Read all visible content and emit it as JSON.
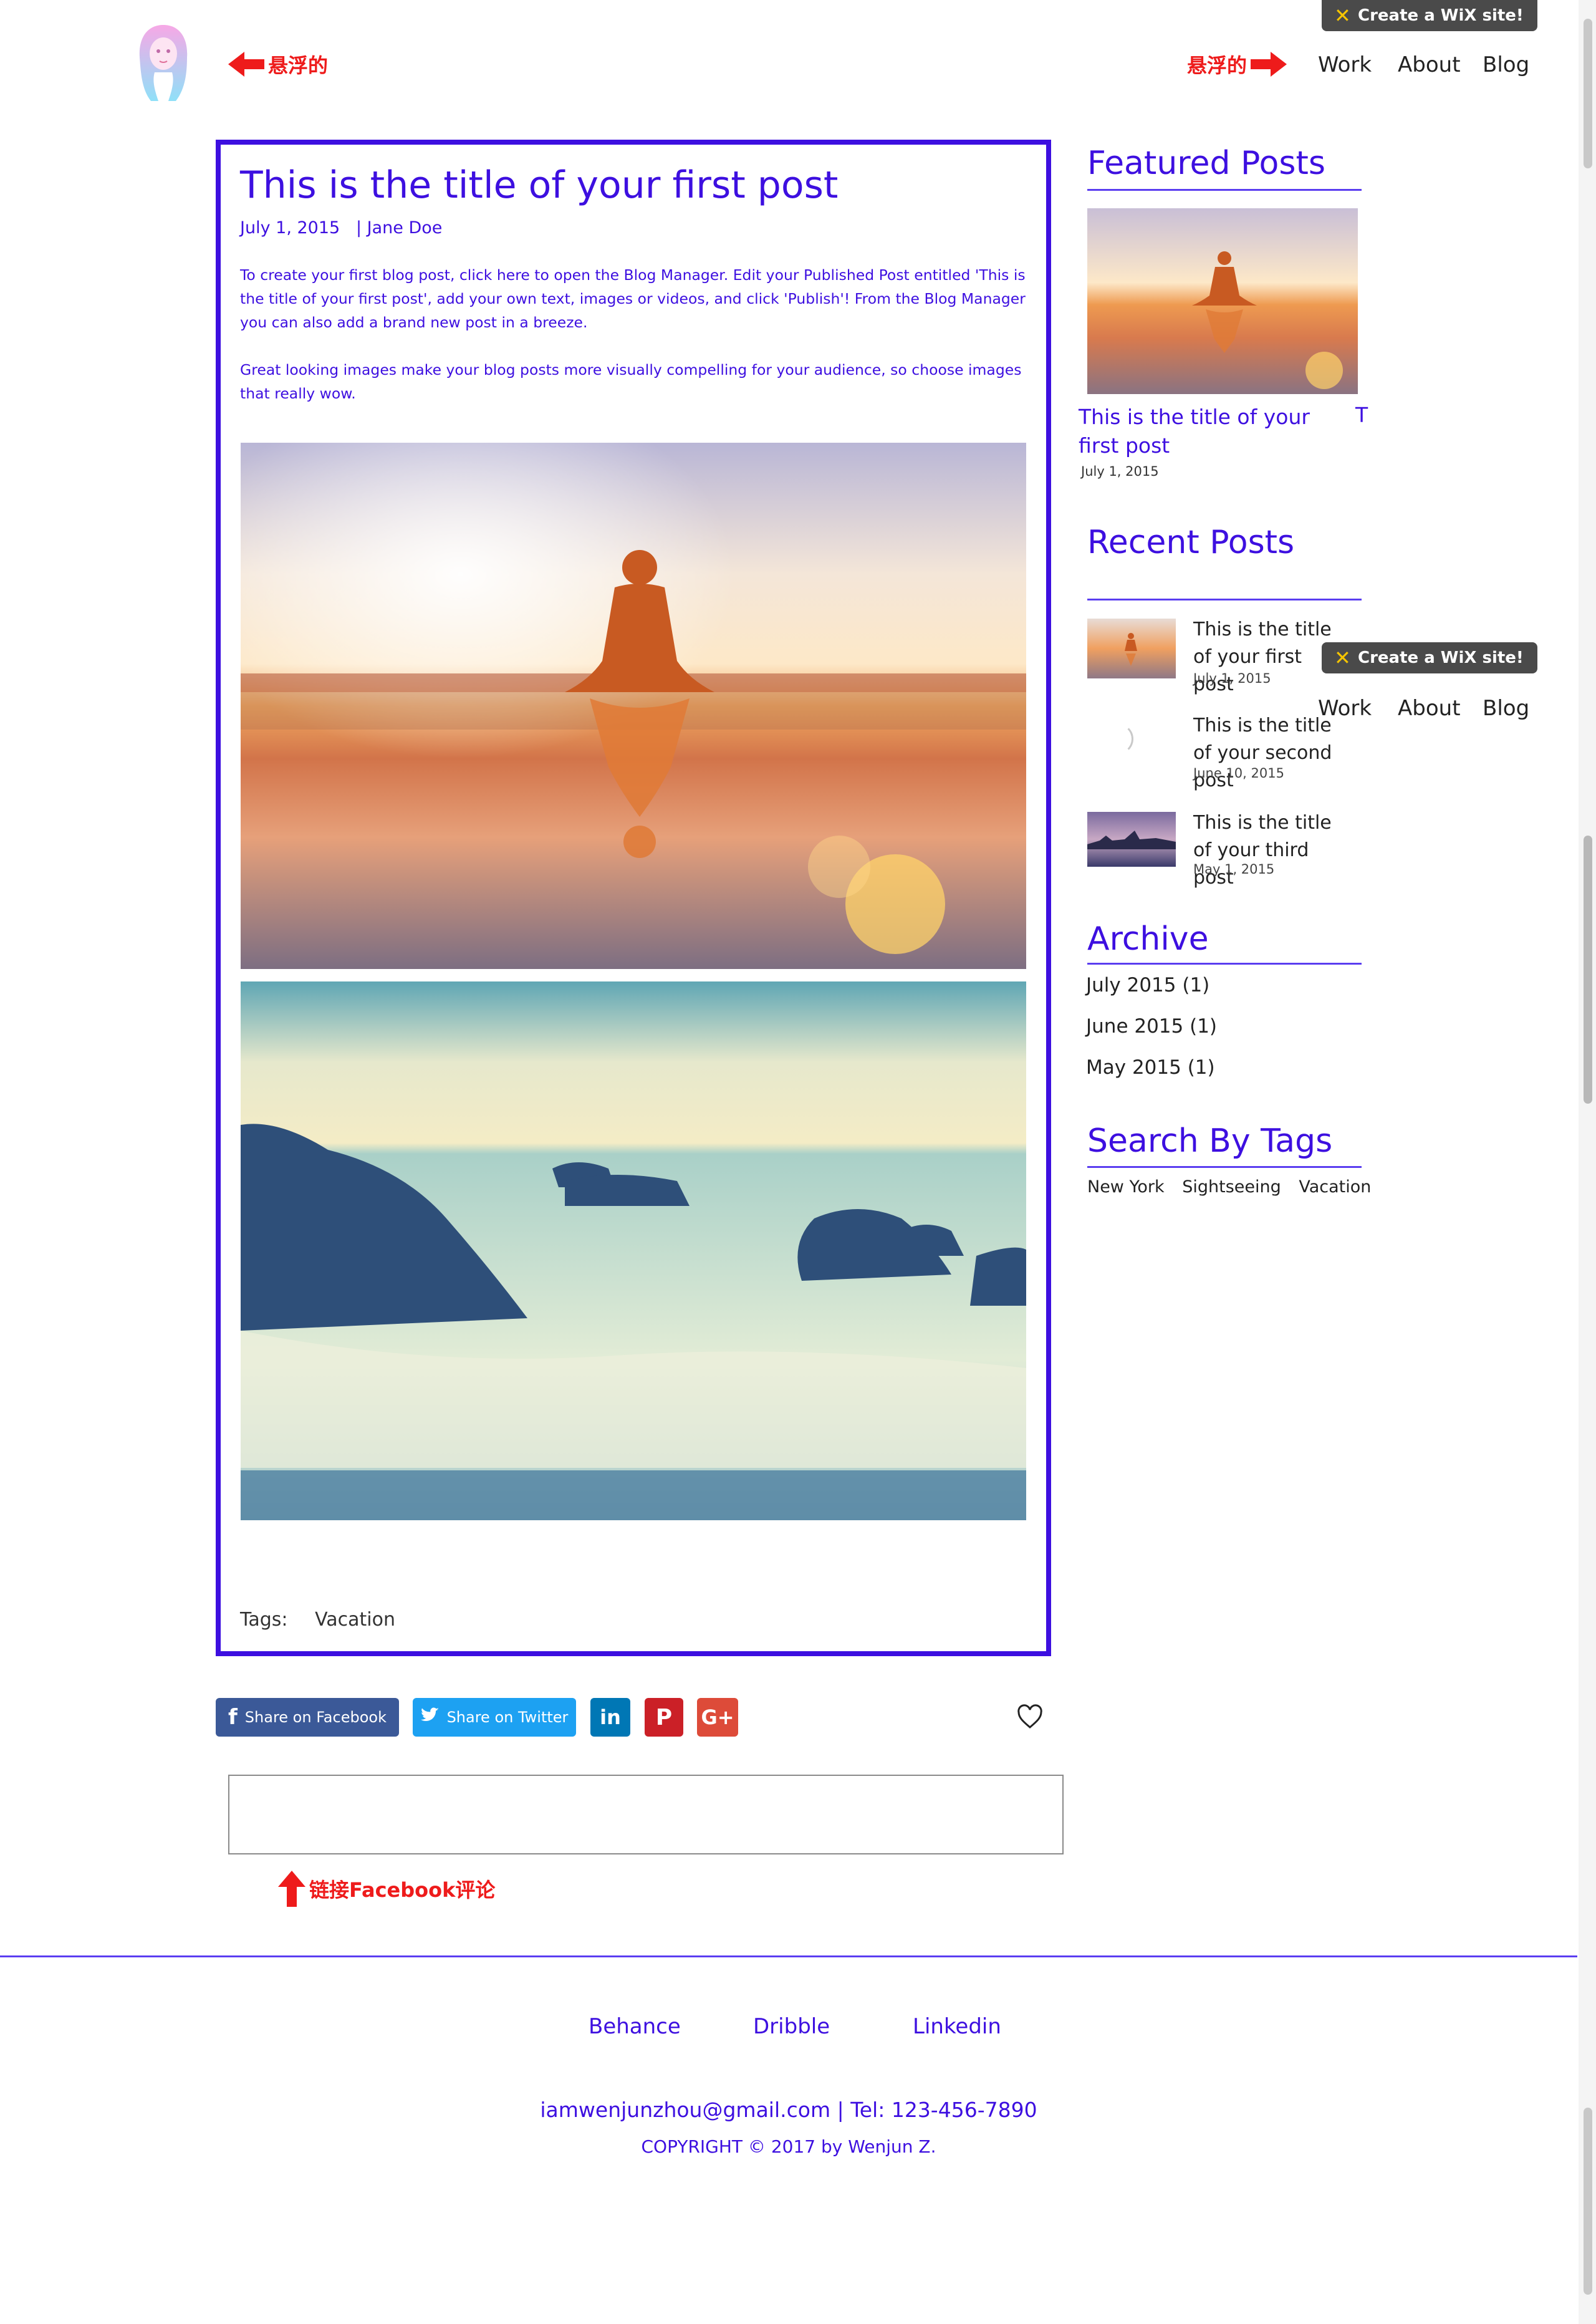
{
  "header": {
    "annotation_left": "悬浮的",
    "annotation_right": "悬浮的",
    "nav": [
      "Work",
      "About",
      "Blog"
    ],
    "wix_badge": "Create a WiX site!"
  },
  "floating_nav": {
    "wix_badge": "Create a WiX site!",
    "nav": [
      "Work",
      "About",
      "Blog"
    ]
  },
  "post": {
    "title": "This is the title of your first post",
    "date": "July 1, 2015",
    "author": "| Jane Doe",
    "paragraph1": "To create your first blog post, click here to open the Blog Manager.  Edit your Published Post entitled 'This is the title of your first post', add your own text, images or videos, and click 'Publish'! From the Blog Manager you can also add a brand new post in a breeze.",
    "paragraph2": "Great looking images make your blog posts more visually compelling for your audience, so choose images that really wow.",
    "tags_label": "Tags:",
    "tags": [
      "Vacation"
    ]
  },
  "share": {
    "facebook": "Share on Facebook",
    "twitter": "Share on Twitter",
    "linkedin": "in",
    "pinterest": "P",
    "google": "G+"
  },
  "comment_annotation": "链接Facebook评论",
  "sidebar": {
    "featured_title": "Featured Posts",
    "featured": {
      "title": "This is the title of your first post",
      "date": "July 1, 2015",
      "next_peek": "T"
    },
    "recent_title": "Recent Posts",
    "recent": [
      {
        "title": "This is the title of your first post",
        "date": "July 1, 2015"
      },
      {
        "title": "This is the title of your second post",
        "date": "June 10, 2015"
      },
      {
        "title": "This is the title of your third post",
        "date": "May 1, 2015"
      }
    ],
    "archive_title": "Archive",
    "archive": [
      "July 2015 (1)",
      "June 2015 (1)",
      "May 2015 (1)"
    ],
    "tags_title": "Search By Tags",
    "tags": [
      "New York",
      "Sightseeing",
      "Vacation"
    ]
  },
  "footer": {
    "links": [
      "Behance",
      "Dribble",
      "Linkedin"
    ],
    "contact": "iamwenjunzhou@gmail.com   |  Tel: 123-456-7890",
    "copyright": "COPYRIGHT © 2017 by Wenjun Z."
  },
  "colors": {
    "accent": "#3d0fe0",
    "annotation": "#ee1b1b",
    "facebook": "#3b5998",
    "twitter": "#1da1f2",
    "linkedin": "#0077b5",
    "pinterest": "#cb2027",
    "google": "#dd4b39"
  }
}
